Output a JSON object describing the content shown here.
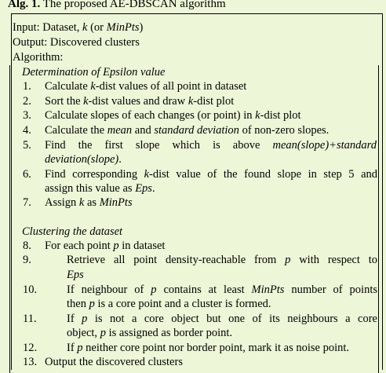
{
  "caption": {
    "label": "Alg. 1.",
    "title": "The proposed AE-DBSCAN algorithm"
  },
  "header": {
    "input_prefix": "Input: Dataset, ",
    "input_k": "k",
    "input_or": " (or ",
    "input_minpts": "MinPts",
    "input_close": ")",
    "output": "Output: Discovered clusters",
    "algorithm": "Algorithm:"
  },
  "section1": {
    "title": "Determination of Epsilon value"
  },
  "section2": {
    "title": "Clustering the dataset"
  },
  "steps": {
    "n1": "1.",
    "n2": "2.",
    "n3": "3.",
    "n4": "4.",
    "n5": "5.",
    "n6": "6.",
    "n7": "7.",
    "n8": "8.",
    "n9": "9.",
    "n10": "10.",
    "n11": "11.",
    "n12": "12.",
    "n13": "13."
  },
  "text": {
    "s1a": "Calculate ",
    "s1b": "k",
    "s1c": "-dist values of all point in dataset",
    "s2a": "Sort the ",
    "s2b": "k",
    "s2c": "-dist values and draw ",
    "s2d": "k",
    "s2e": "-dist plot",
    "s3a": "Calculate slopes of each changes (or point) in ",
    "s3b": "k",
    "s3c": "-dist plot",
    "s4a": "Calculate the ",
    "s4b": "mean",
    "s4c": " and ",
    "s4d": "standard deviation",
    "s4e": " of non-zero slopes.",
    "s5a": "Find the first slope which is above ",
    "s5b": "mean(slope)+standard",
    "s5c": "deviation(slope)",
    "s5d": ".",
    "s6a": "Find corresponding ",
    "s6b": "k",
    "s6c": "-dist value of the found slope in step 5 and",
    "s6d": "assign this value as ",
    "s6e": "Eps",
    "s6f": ".",
    "s7a": "Assign ",
    "s7b": "k",
    "s7c": " as ",
    "s7d": "MinPts",
    "s8a": "For each point ",
    "s8b": "p",
    "s8c": " in dataset",
    "s9a": "Retrieve all point density-reachable from ",
    "s9b": "p",
    "s9c": " with respect to",
    "s9d": "Eps",
    "s10a": "If neighbour of ",
    "s10b": "p",
    "s10c": " contains at least ",
    "s10d": "MinPts",
    "s10e": " number of points",
    "s10f": "then ",
    "s10g": "p",
    "s10h": " is a core point and a cluster is formed.",
    "s11a": "If ",
    "s11b": "p",
    "s11c": " is not a core object but one of its neighbours a core",
    "s11d": "object, ",
    "s11e": "p",
    "s11f": " is assigned as border point.",
    "s12a": "If ",
    "s12b": "p",
    "s12c": " neither core point nor border point, mark it as noise point.",
    "s13": "Output the discovered clusters"
  }
}
